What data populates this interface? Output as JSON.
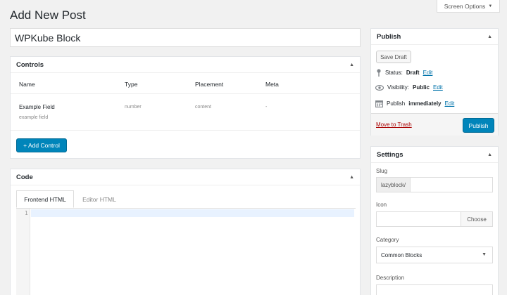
{
  "page": {
    "title": "Add New Post",
    "screen_options": "Screen Options"
  },
  "post_title": {
    "value": "WPKube Block"
  },
  "controls": {
    "title": "Controls",
    "headers": [
      "Name",
      "Type",
      "Placement",
      "Meta"
    ],
    "rows": [
      {
        "name": "Example Field",
        "sub": "example field",
        "type": "number",
        "placement": "content",
        "meta": "-"
      }
    ],
    "add_button": "+ Add Control"
  },
  "code": {
    "title": "Code",
    "tabs": [
      {
        "label": "Frontend HTML",
        "active": true
      },
      {
        "label": "Editor HTML",
        "active": false
      }
    ],
    "line_number": "1"
  },
  "publish": {
    "title": "Publish",
    "save_draft": "Save Draft",
    "status_label": "Status:",
    "status_value": "Draft",
    "visibility_label": "Visibility:",
    "visibility_value": "Public",
    "publish_label": "Publish",
    "publish_value": "immediately",
    "edit": "Edit",
    "trash": "Move to Trash",
    "publish_button": "Publish"
  },
  "settings": {
    "title": "Settings",
    "slug_label": "Slug",
    "slug_prefix": "lazyblock/",
    "slug_value": "",
    "icon_label": "Icon",
    "choose": "Choose",
    "category_label": "Category",
    "category_value": "Common Blocks",
    "description_label": "Description"
  },
  "colors": {
    "accent": "#0085ba",
    "link": "#0073aa",
    "danger": "#a00"
  }
}
